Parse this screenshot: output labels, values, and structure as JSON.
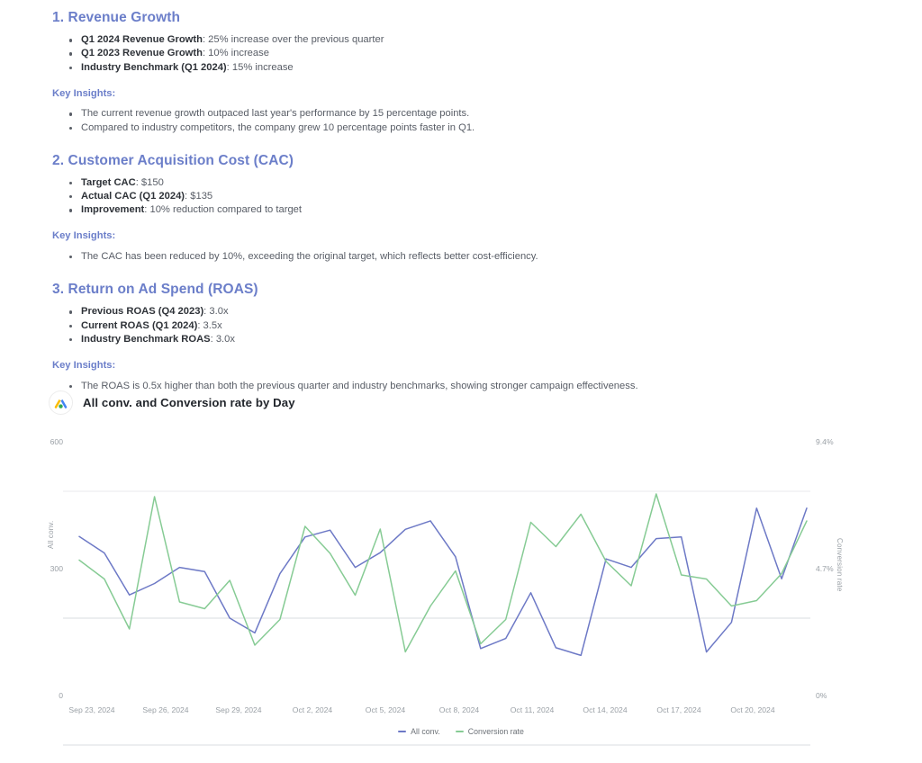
{
  "report": {
    "sections": [
      {
        "title": "1. Revenue Growth",
        "bullets": [
          {
            "label": "Q1 2024 Revenue Growth",
            "value": ": 25% increase over the previous quarter"
          },
          {
            "label": "Q1 2023 Revenue Growth",
            "value": ": 10% increase"
          },
          {
            "label": "Industry Benchmark (Q1 2024)",
            "value": ": 15% increase"
          }
        ],
        "insights_label": "Key Insights:",
        "insights": [
          "The current revenue growth outpaced last year's performance by 15 percentage points.",
          "Compared to industry competitors, the company grew 10 percentage points faster in Q1."
        ]
      },
      {
        "title": "2. Customer Acquisition Cost (CAC)",
        "bullets": [
          {
            "label": "Target CAC",
            "value": ": $150"
          },
          {
            "label": "Actual CAC (Q1 2024)",
            "value": ": $135"
          },
          {
            "label": "Improvement",
            "value": ": 10% reduction compared to target"
          }
        ],
        "insights_label": "Key Insights:",
        "insights": [
          "The CAC has been reduced by 10%, exceeding the original target, which reflects better cost-efficiency."
        ]
      },
      {
        "title": "3. Return on Ad Spend (ROAS)",
        "bullets": [
          {
            "label": "Previous ROAS (Q4 2023)",
            "value": ": 3.0x"
          },
          {
            "label": "Current ROAS (Q1 2024)",
            "value": ": 3.5x"
          },
          {
            "label": "Industry Benchmark ROAS",
            "value": ": 3.0x"
          }
        ],
        "insights_label": "Key Insights:",
        "insights": [
          "The ROAS is 0.5x higher than both the previous quarter and industry benchmarks, showing stronger campaign effectiveness."
        ]
      }
    ]
  },
  "chart_card": {
    "logo_name": "google-ads-logo",
    "title": "All conv. and Conversion rate by Day"
  },
  "chart_data": {
    "type": "line",
    "title": "All conv. and Conversion rate by Day",
    "xlabel": "",
    "ylabel": "All conv.",
    "y2label": "Conversion rate",
    "grid": true,
    "legend_position": "bottom",
    "ylim": [
      0,
      600
    ],
    "y2lim": [
      0,
      9.4
    ],
    "yticks": [
      "0",
      "300",
      "600"
    ],
    "y2ticks": [
      "0%",
      "4.7%",
      "9.4%"
    ],
    "xtick_labels": [
      "Sep 23, 2024",
      "Sep 26, 2024",
      "Sep 29, 2024",
      "Oct 2, 2024",
      "Oct 5, 2024",
      "Oct 8, 2024",
      "Oct 11, 2024",
      "Oct 14, 2024",
      "Oct 17, 2024",
      "Oct 20, 2024"
    ],
    "x": [
      "Sep 23, 2024",
      "Sep 24, 2024",
      "Sep 25, 2024",
      "Sep 26, 2024",
      "Sep 27, 2024",
      "Sep 28, 2024",
      "Sep 29, 2024",
      "Sep 30, 2024",
      "Oct 1, 2024",
      "Oct 2, 2024",
      "Oct 3, 2024",
      "Oct 4, 2024",
      "Oct 5, 2024",
      "Oct 6, 2024",
      "Oct 7, 2024",
      "Oct 8, 2024",
      "Oct 9, 2024",
      "Oct 10, 2024",
      "Oct 11, 2024",
      "Oct 12, 2024",
      "Oct 13, 2024",
      "Oct 14, 2024",
      "Oct 15, 2024",
      "Oct 16, 2024",
      "Oct 17, 2024",
      "Oct 18, 2024",
      "Oct 19, 2024",
      "Oct 20, 2024",
      "Oct 21, 2024",
      "Oct 22, 2024"
    ],
    "series": [
      {
        "name": "All conv.",
        "color": "#6d79c6",
        "axis": "left",
        "values": [
          493,
          454,
          355,
          382,
          420,
          410,
          300,
          265,
          405,
          492,
          508,
          420,
          455,
          510,
          530,
          445,
          228,
          252,
          360,
          230,
          212,
          440,
          420,
          488,
          492,
          220,
          290,
          560,
          393,
          560
        ]
      },
      {
        "name": "Conversion rate",
        "color": "#86cb94",
        "axis": "right",
        "values": [
          6.85,
          6.15,
          4.3,
          9.2,
          5.3,
          5.05,
          6.1,
          3.7,
          4.65,
          8.1,
          7.1,
          5.55,
          8.0,
          3.45,
          5.15,
          6.45,
          3.75,
          4.65,
          8.25,
          7.35,
          8.55,
          6.8,
          5.9,
          9.3,
          6.3,
          6.15,
          5.15,
          5.35,
          6.35,
          8.3
        ]
      }
    ]
  }
}
